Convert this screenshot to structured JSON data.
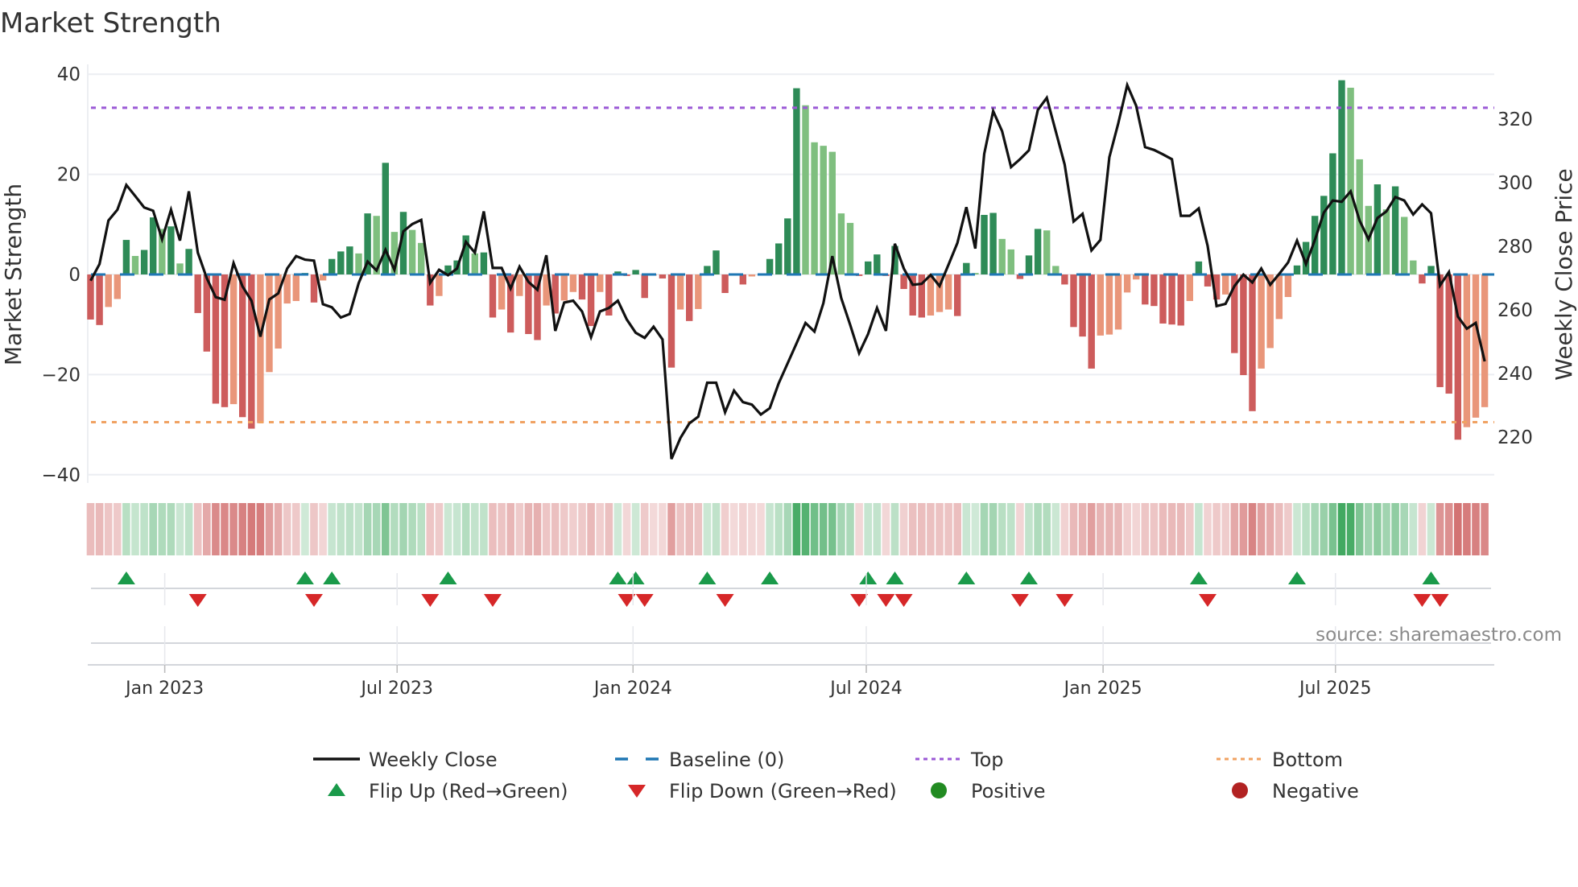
{
  "chart_data": {
    "type": "bar",
    "title": "Market Strength",
    "ylabel": "Market Strength",
    "y2label": "Weekly Close Price",
    "ylim": [
      -40,
      40
    ],
    "y2lim": [
      207,
      334
    ],
    "yticks": [
      "40",
      "20",
      "0",
      "−20",
      "−40"
    ],
    "ytick_values": [
      40,
      20,
      0,
      -20,
      -40
    ],
    "y2ticks": [
      "320",
      "300",
      "280",
      "260",
      "240",
      "220"
    ],
    "y2tick_values": [
      320,
      300,
      280,
      260,
      240,
      220
    ],
    "xticks": [
      "Jan 2023",
      "Jul 2023",
      "Jan 2024",
      "Jul 2024",
      "Jan 2025",
      "Jul 2025"
    ],
    "frequency": "weekly",
    "grid": true,
    "top_level": 33.3,
    "bottom_level": -29.5,
    "baseline": 0,
    "strength": [
      -9,
      -10.1,
      -6.5,
      -4.9,
      6.9,
      3.7,
      4.9,
      11.4,
      9.1,
      9.6,
      2.2,
      5.1,
      -7.7,
      -15.4,
      -25.8,
      -26.5,
      -25.9,
      -28.5,
      -30.8,
      -29.7,
      -19.5,
      -14.8,
      -5.8,
      -5.3,
      0.3,
      -5.6,
      -1.2,
      3.1,
      4.6,
      5.6,
      4.2,
      12.2,
      11.7,
      22.3,
      8.5,
      12.5,
      8.9,
      6.3,
      -6.2,
      -4.3,
      1.8,
      2.8,
      7.8,
      4.2,
      4.4,
      -8.6,
      -7,
      -11.6,
      -4.3,
      -11.9,
      -13.1,
      -6.2,
      -7.8,
      -5.2,
      -3.5,
      -5,
      -10.3,
      -3.5,
      -8.2,
      0.6,
      -0.3,
      0.9,
      -4.7,
      -0.2,
      -0.8,
      -18.6,
      -7,
      -9.3,
      -6.9,
      1.7,
      4.8,
      -3.7,
      -0.2,
      -2,
      -0.4,
      -0.2,
      3.1,
      6.2,
      11.2,
      37.2,
      33.8,
      26.4,
      25.7,
      24.5,
      12.2,
      10.3,
      -0.3,
      2.6,
      4,
      -0.3,
      5.7,
      -2.9,
      -8.2,
      -8.6,
      -8.2,
      -7.5,
      -7,
      -8.3,
      2.3,
      0.3,
      11.9,
      12.3,
      7.1,
      5,
      -0.9,
      3.8,
      9.1,
      8.8,
      1.7,
      -2,
      -10.5,
      -12.4,
      -18.8,
      -12.2,
      -12,
      -11,
      -3.6,
      -1,
      -6,
      -6.3,
      -9.8,
      -10,
      -10.2,
      -5.3,
      2.6,
      -2.4,
      -5,
      -4,
      -15.7,
      -20.1,
      -27.3,
      -18.8,
      -14.7,
      -8.9,
      -4.5,
      1.8,
      6.5,
      11.7,
      15.7,
      24.2,
      38.8,
      37.3,
      23,
      13.7,
      18,
      13,
      17.6,
      11.5,
      2.8,
      -1.8,
      1.7,
      -22.5,
      -23.8,
      -33,
      -30.5,
      -28.6,
      -26.5
    ],
    "weekly_close": [
      269.2,
      274.4,
      288.1,
      291.5,
      299.3,
      295.8,
      292.2,
      291.2,
      282.2,
      291.5,
      281.8,
      297.3,
      278,
      270,
      264,
      263.2,
      274.7,
      267.4,
      262.9,
      251.6,
      263.3,
      265.2,
      273,
      276.9,
      275.8,
      275.5,
      261.8,
      260.8,
      257.6,
      258.7,
      268.4,
      275.2,
      272.4,
      278.9,
      272.6,
      284.7,
      287,
      288.3,
      268.5,
      272.6,
      270.9,
      273,
      281.4,
      278,
      291,
      273.2,
      273.2,
      266.7,
      273.6,
      268.8,
      266.3,
      277.2,
      253.4,
      262.3,
      262.9,
      259.5,
      251.4,
      259.5,
      260.6,
      262.9,
      257,
      252.8,
      251.2,
      254.7,
      250.7,
      213.1,
      219.7,
      224.3,
      226.4,
      237.1,
      237.1,
      227.8,
      234.6,
      231,
      230.2,
      227.1,
      229.1,
      236.9,
      243.2,
      249.5,
      255.9,
      253.2,
      262.1,
      276.9,
      263.7,
      255.3,
      246.4,
      252.4,
      260.6,
      253.4,
      280.8,
      273,
      267.9,
      268.2,
      271,
      267.5,
      274.2,
      281.1,
      292.3,
      279.3,
      309.1,
      322.5,
      316.2,
      304.9,
      307.4,
      310.2,
      322.9,
      326.7,
      316.2,
      305.7,
      287.8,
      290.2,
      278.7,
      282,
      308,
      318.7,
      330.7,
      324.2,
      311.2,
      310.3,
      308.9,
      307.4,
      289.6,
      289.6,
      291.9,
      280.1,
      261.2,
      261.9,
      267.5,
      271.1,
      268.6,
      273,
      267.9,
      271.3,
      274.9,
      281.8,
      274.4,
      282,
      290.6,
      294.4,
      294,
      297.3,
      288.1,
      282.2,
      288.9,
      291,
      295.5,
      294.4,
      290,
      293.2,
      290.4,
      267.7,
      271.9,
      257.9,
      254.1,
      255.9,
      243.8
    ],
    "flip_up_weeks": [
      4,
      24,
      27,
      40,
      59,
      61,
      69,
      76,
      87,
      90,
      98,
      105,
      124,
      135,
      150
    ],
    "flip_down_weeks": [
      12,
      25,
      38,
      45,
      60,
      62,
      71,
      86,
      89,
      91,
      104,
      109,
      125,
      149,
      151
    ],
    "legend": {
      "placement": "bottom",
      "items": [
        {
          "label": "Weekly Close",
          "key": "line"
        },
        {
          "label": "Baseline (0)",
          "key": "baseline"
        },
        {
          "label": "Top",
          "key": "top"
        },
        {
          "label": "Bottom",
          "key": "bottom"
        },
        {
          "label": "Flip Up (Red→Green)",
          "key": "flipup"
        },
        {
          "label": "Flip Down (Green→Red)",
          "key": "flipdown"
        },
        {
          "label": "Positive",
          "key": "positive"
        },
        {
          "label": "Negative",
          "key": "negative"
        }
      ]
    },
    "source": "source: sharemaestro.com"
  },
  "colors": {
    "up_strong": "#2e8b57",
    "up_weak": "#7fbf7f",
    "down_strong": "#cd5c5c",
    "down_weak": "#e9967a",
    "line": "#111111",
    "baseline": "#1f77b4",
    "top": "#9b59d6",
    "bottom": "#f0a262",
    "flip_up": "#1a9a4a",
    "flip_down": "#d62728",
    "positive": "#228b22",
    "negative": "#b22222"
  }
}
